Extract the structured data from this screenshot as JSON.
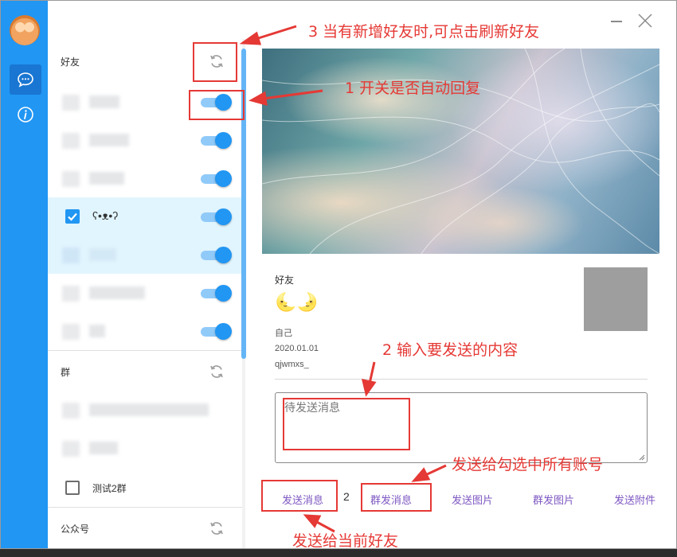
{
  "friends_section": {
    "title": "好友"
  },
  "groups_section": {
    "title": "群",
    "group_row_label": "测试2群"
  },
  "official_section": {
    "title": "公众号"
  },
  "selected_friend_name": "ʕ•ᴥ•ʔ",
  "profile": {
    "label": "好友",
    "name": "🌜🌛",
    "remark": "自己",
    "date": "2020.01.01",
    "account": "qjwmxs_"
  },
  "compose": {
    "placeholder": "待发送消息"
  },
  "actions": {
    "send_message": "发送消息",
    "count": "2",
    "group_message": "群发消息",
    "send_image": "发送图片",
    "group_image": "群发图片",
    "send_attachment": "发送附件"
  },
  "annotations": {
    "a1": "1 开关是否自动回复",
    "a2": "2 输入要发送的内容",
    "a3": "3 当有新增好友时,可点击刷新好友",
    "a4": "发送给勾选中所有账号",
    "a5": "发送给当前好友"
  },
  "colors": {
    "accent": "#2196f3",
    "annotation": "#e53935",
    "action_text": "#7e57c2"
  }
}
